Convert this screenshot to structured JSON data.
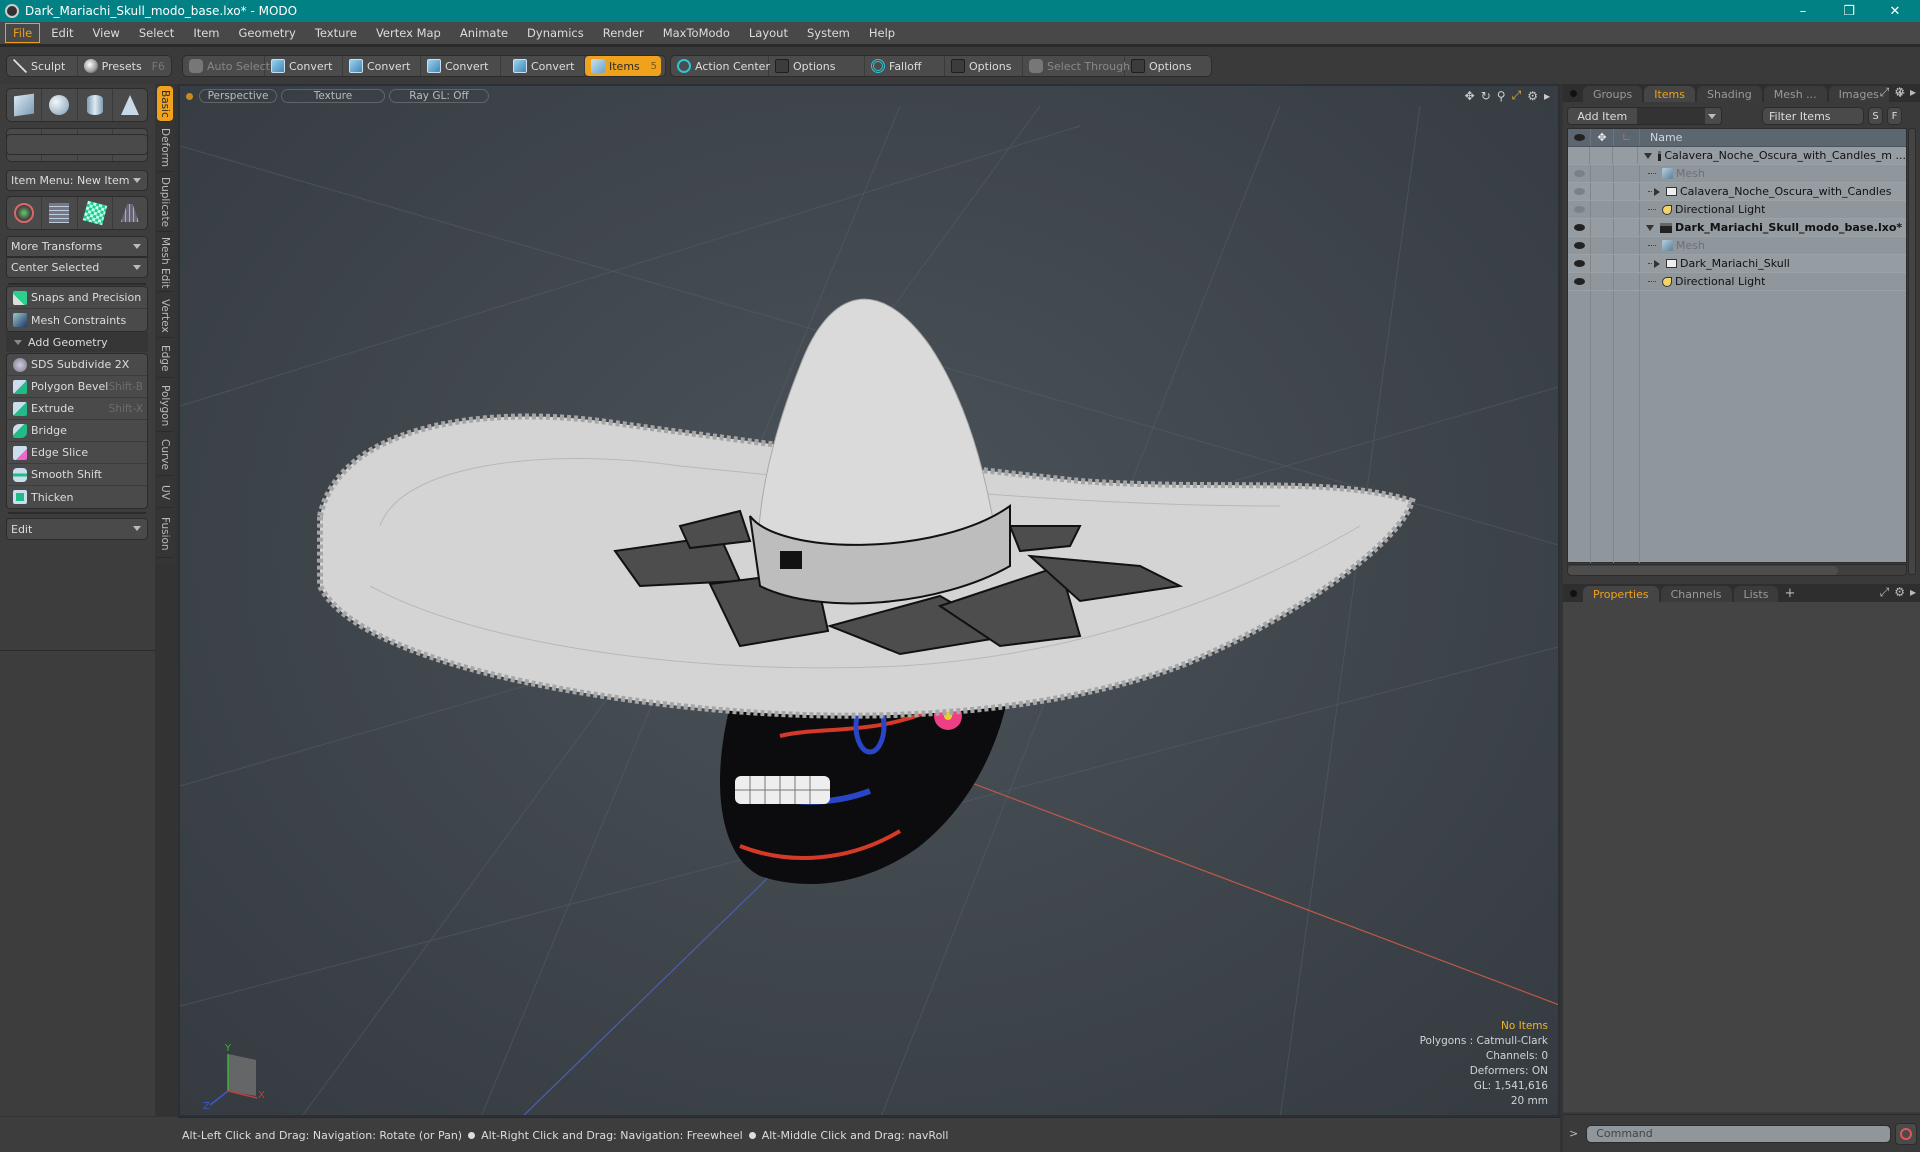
{
  "window": {
    "title": "Dark_Mariachi_Skull_modo_base.lxo* - MODO",
    "controls": [
      "minimize",
      "restore",
      "close"
    ]
  },
  "menu": [
    "File",
    "Edit",
    "View",
    "Select",
    "Item",
    "Geometry",
    "Texture",
    "Vertex Map",
    "Animate",
    "Dynamics",
    "Render",
    "MaxToModo",
    "Layout",
    "System",
    "Help"
  ],
  "active_menu": "File",
  "toolbar": {
    "sculpt": "Sculpt",
    "presets": "Presets",
    "presets_shortcut": "F6",
    "auto_select": "Auto Select",
    "convert_1": "Convert",
    "convert_2": "Convert",
    "convert_3": "Convert",
    "convert_4": "Convert",
    "items": "Items",
    "items_count": "5",
    "action_center": "Action Center",
    "options_1": "Options",
    "falloff": "Falloff",
    "options_2": "Options",
    "select_through": "Select Through",
    "options_3": "Options"
  },
  "left_panel": {
    "vertical_tabs": [
      "Basic",
      "Deform",
      "Duplicate",
      "Mesh Edit",
      "Vertex",
      "Edge",
      "Polygon",
      "Curve",
      "UV",
      "Fusion"
    ],
    "active_tab": "Basic",
    "primitives_row1": [
      "cube-icon",
      "sphere-icon",
      "cylinder-icon",
      "cone-icon"
    ],
    "primitives_row2": [
      "torus-icon",
      "capsule-icon",
      "pen-icon",
      "text-icon"
    ],
    "item_menu": "Item Menu: New Item",
    "transforms_row": [
      "transform-icon",
      "grid-icon",
      "checker-cube-icon",
      "plane-icon"
    ],
    "more_transforms": "More Transforms",
    "center_selected": "Center Selected",
    "snaps": "Snaps and Precision",
    "mesh_constraints": "Mesh Constraints",
    "add_geometry_header": "Add Geometry",
    "tools": [
      {
        "label": "SDS Subdivide 2X",
        "shortcut": ""
      },
      {
        "label": "Polygon Bevel",
        "shortcut": "Shift-B"
      },
      {
        "label": "Extrude",
        "shortcut": "Shift-X"
      },
      {
        "label": "Bridge",
        "shortcut": ""
      },
      {
        "label": "Edge Slice",
        "shortcut": ""
      },
      {
        "label": "Smooth Shift",
        "shortcut": ""
      },
      {
        "label": "Thicken",
        "shortcut": ""
      }
    ],
    "edit_dropdown": "Edit"
  },
  "viewport": {
    "view": "Perspective",
    "shading": "Texture",
    "raygl": "Ray GL: Off",
    "info": {
      "selection": "No Items",
      "polygons": "Polygons : Catmull-Clark",
      "channels": "Channels: 0",
      "deformers": "Deformers: ON",
      "gl": "GL: 1,541,616",
      "scale": "20 mm"
    },
    "axis_labels": {
      "x": "X",
      "y": "Y",
      "z": "Z"
    }
  },
  "status_bar": {
    "hints": [
      "Alt-Left Click and Drag: Navigation: Rotate (or Pan)",
      "Alt-Right Click and Drag: Navigation: Freewheel",
      "Alt-Middle Click and Drag: navRoll"
    ]
  },
  "right_panel": {
    "tabs": [
      "Groups",
      "Items",
      "Shading",
      "Mesh ...",
      "Images"
    ],
    "active_tab": "Items",
    "add_item": "Add Item",
    "filter_placeholder": "Filter Items",
    "filter_s": "S",
    "filter_f": "F",
    "column_name": "Name",
    "tree": [
      {
        "name": "Calavera_Noche_Oscura_with_Candles_m ...",
        "type": "scene",
        "expanded": true,
        "depth": 0,
        "visible": false,
        "bold": false
      },
      {
        "name": "Mesh",
        "type": "mesh",
        "depth": 1,
        "visible": true,
        "dim": true
      },
      {
        "name": "Calavera_Noche_Oscura_with_Candles",
        "type": "group",
        "collapsed": true,
        "depth": 1,
        "visible": true
      },
      {
        "name": "Directional Light",
        "type": "light",
        "depth": 1,
        "visible": true
      },
      {
        "name": "Dark_Mariachi_Skull_modo_base.lxo*",
        "type": "scene",
        "expanded": true,
        "depth": 0,
        "visible": true,
        "bold": true
      },
      {
        "name": "Mesh",
        "type": "mesh",
        "depth": 1,
        "visible": true,
        "dim": true
      },
      {
        "name": "Dark_Mariachi_Skull",
        "type": "group",
        "collapsed": true,
        "depth": 1,
        "visible": true
      },
      {
        "name": "Directional Light",
        "type": "light",
        "depth": 1,
        "visible": true
      }
    ],
    "bottom_tabs": [
      "Properties",
      "Channels",
      "Lists"
    ],
    "bottom_active": "Properties",
    "command_placeholder": "Command",
    "command_prompt": ">"
  },
  "colors": {
    "titlebar": "#028184",
    "accent": "#f0a21d",
    "info_warn": "#f0b428"
  }
}
